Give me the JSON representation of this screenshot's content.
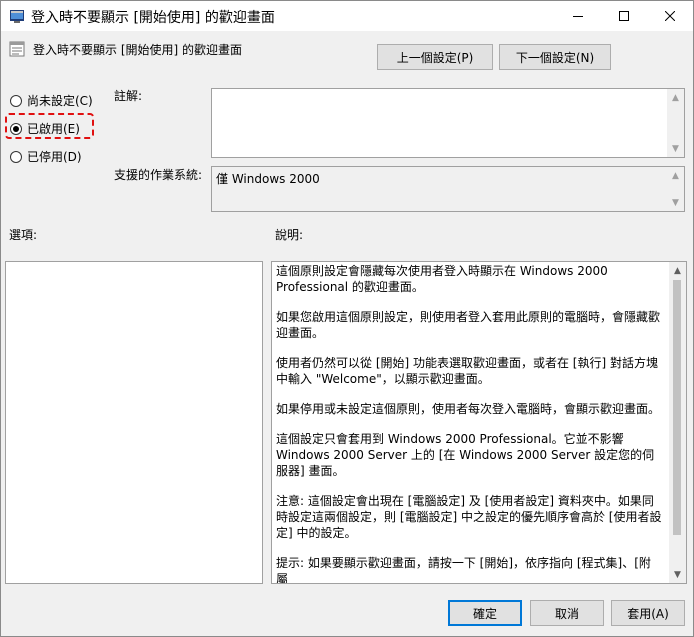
{
  "window": {
    "title": "登入時不要顯示 [開始使用] 的歡迎畫面"
  },
  "policy": {
    "name": "登入時不要顯示 [開始使用] 的歡迎畫面",
    "prev_label": "上一個設定(P)",
    "next_label": "下一個設定(N)"
  },
  "state": {
    "options": [
      {
        "label": "尚未設定(C)",
        "checked": false
      },
      {
        "label": "已啟用(E)",
        "checked": true
      },
      {
        "label": "已停用(D)",
        "checked": false
      }
    ]
  },
  "comment": {
    "label": "註解:",
    "value": ""
  },
  "supported": {
    "label": "支援的作業系統:",
    "value": "僅 Windows 2000"
  },
  "options_label": "選項:",
  "help": {
    "label": "說明:",
    "paragraphs": [
      "這個原則設定會隱藏每次使用者登入時顯示在 Windows 2000 Professional 的歡迎畫面。",
      "如果您啟用這個原則設定，則使用者登入套用此原則的電腦時，會隱藏歡迎畫面。",
      "使用者仍然可以從 [開始] 功能表選取歡迎畫面，或者在 [執行] 對話方塊中輸入 \"Welcome\"，以顯示歡迎畫面。",
      "如果停用或未設定這個原則，使用者每次登入電腦時，會顯示歡迎畫面。",
      "這個設定只會套用到 Windows 2000 Professional。它並不影響 Windows 2000 Server 上的 [在 Windows 2000 Server 設定您的伺服器] 畫面。",
      "注意: 這個設定會出現在 [電腦設定] 及 [使用者設定] 資料夾中。如果同時設定這兩個設定，則 [電腦設定] 中之設定的優先順序會高於 [使用者設定] 中的設定。",
      "提示: 如果要顯示歡迎畫面，請按一下 [開始]，依序指向 [程式集]、[附屬"
    ]
  },
  "buttons": {
    "ok": "確定",
    "cancel": "取消",
    "apply": "套用(A)"
  },
  "colors": {
    "accent": "#0078d7",
    "highlight": "#e01010"
  }
}
